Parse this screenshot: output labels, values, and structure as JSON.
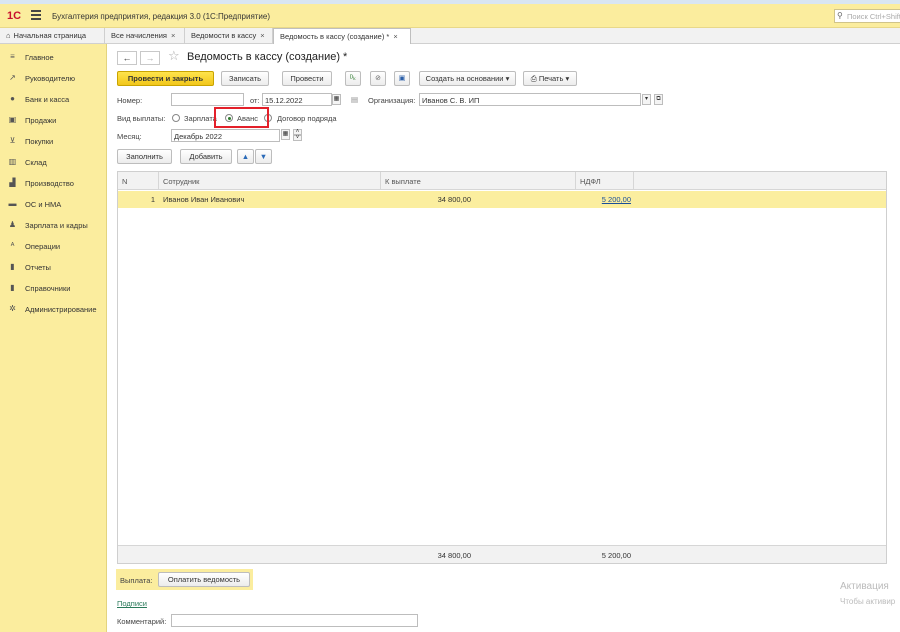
{
  "app": {
    "logo": "1С",
    "title": "Бухгалтерия предприятия, редакция 3.0  (1С:Предприятие)",
    "search_placeholder": "Поиск Ctrl+Shift+F"
  },
  "tabs": [
    {
      "label": "Начальная страница"
    },
    {
      "label": "Все начисления",
      "close": "×"
    },
    {
      "label": "Ведомости в кассу",
      "close": "×"
    },
    {
      "label": "Ведомость в кассу (создание) *",
      "close": "×"
    }
  ],
  "sidebar": {
    "items": [
      {
        "label": "Главное",
        "icon": "menu-icon"
      },
      {
        "label": "Руководителю",
        "icon": "trend-icon"
      },
      {
        "label": "Банк и касса",
        "icon": "coin-icon"
      },
      {
        "label": "Продажи",
        "icon": "bag-icon"
      },
      {
        "label": "Покупки",
        "icon": "cart-icon"
      },
      {
        "label": "Склад",
        "icon": "warehouse-icon"
      },
      {
        "label": "Производство",
        "icon": "factory-icon"
      },
      {
        "label": "ОС и НМА",
        "icon": "truck-icon"
      },
      {
        "label": "Зарплата и кадры",
        "icon": "person-icon"
      },
      {
        "label": "Операции",
        "icon": "operations-icon"
      },
      {
        "label": "Отчеты",
        "icon": "chart-icon"
      },
      {
        "label": "Справочники",
        "icon": "book-icon"
      },
      {
        "label": "Администрирование",
        "icon": "gear-icon"
      }
    ]
  },
  "document": {
    "title": "Ведомость в кассу (создание) *",
    "toolbar": {
      "post_close": "Провести и закрыть",
      "save": "Записать",
      "post": "Провести",
      "create_based": "Создать на основании",
      "print": "Печать"
    },
    "number_label": "Номер:",
    "number_value": "",
    "date_label": "от:",
    "date_value": "15.12.2022",
    "org_label": "Организация:",
    "org_value": "Иванов С. В. ИП",
    "payment_type_label": "Вид выплаты:",
    "payment_options": [
      "Зарплата",
      "Аванс",
      "Договор подряда"
    ],
    "payment_selected": "Аванс",
    "month_label": "Месяц:",
    "month_value": "Декабрь 2022",
    "fill_button": "Заполнить",
    "add_button": "Добавить"
  },
  "table": {
    "columns": [
      "N",
      "Сотрудник",
      "К выплате",
      "НДФЛ"
    ],
    "rows": [
      {
        "n": "1",
        "employee": "Иванов Иван Иванович",
        "to_pay": "34 800,00",
        "ndfl": "5 200,00"
      }
    ],
    "totals": {
      "to_pay": "34 800,00",
      "ndfl": "5 200,00"
    }
  },
  "footer": {
    "payment_label": "Выплата:",
    "pay_button": "Оплатить ведомость",
    "signatures_link": "Подписи",
    "comment_label": "Комментарий:",
    "comment_value": ""
  },
  "watermark": {
    "line1": "Активация",
    "line2": "Чтобы активир"
  }
}
